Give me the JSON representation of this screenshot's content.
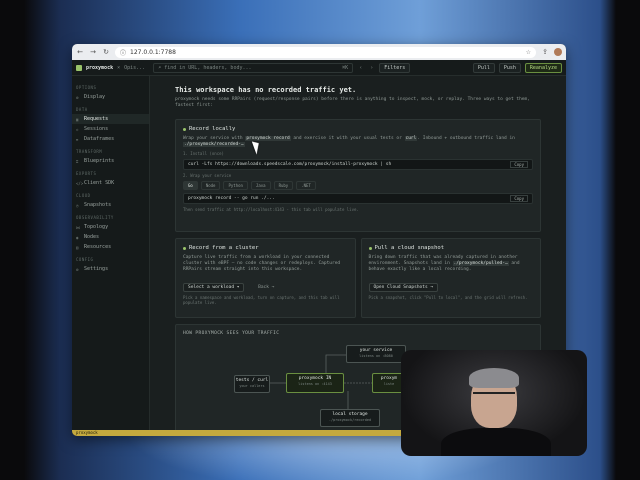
{
  "browser": {
    "url": "127.0.0.1:7788",
    "back": "←",
    "forward": "→",
    "reload": "↻",
    "info": "ⓘ",
    "star": "☆",
    "share": "⇪"
  },
  "topbar": {
    "brand": "proxymock",
    "tab_sep": "×",
    "tab_label": "Opis...",
    "search_placeholder": "find in URL, headers, body...",
    "shortcut": "⌘K",
    "prev": "‹",
    "next": "›",
    "filters": "Filters",
    "pull": "Pull",
    "push": "Push",
    "reanalyze": "Reanalyze"
  },
  "sidebar": {
    "sections": [
      {
        "title": "OPTIONS",
        "items": [
          {
            "icon": "⚙",
            "label": "Display",
            "active": false
          }
        ]
      },
      {
        "title": "DATA",
        "items": [
          {
            "icon": "▣",
            "label": "Requests",
            "active": true
          },
          {
            "icon": "◇",
            "label": "Sessions",
            "active": false
          },
          {
            "icon": "≡",
            "label": "Dataframes",
            "active": false
          }
        ]
      },
      {
        "title": "TRANSFORM",
        "items": [
          {
            "icon": "⌗",
            "label": "Blueprints",
            "active": false
          }
        ]
      },
      {
        "title": "EXPORTS",
        "items": [
          {
            "icon": "</>",
            "label": "Client SDK",
            "active": false
          }
        ]
      },
      {
        "title": "CLOUD",
        "items": [
          {
            "icon": "◷",
            "label": "Snapshots",
            "active": false
          }
        ]
      },
      {
        "title": "OBSERVABILITY",
        "items": [
          {
            "icon": "⋈",
            "label": "Topology",
            "active": false
          },
          {
            "icon": "◉",
            "label": "Nodes",
            "active": false
          },
          {
            "icon": "▤",
            "label": "Resources",
            "active": false
          }
        ]
      },
      {
        "title": "CONFIG",
        "items": [
          {
            "icon": "⚙",
            "label": "Settings",
            "active": false
          }
        ]
      }
    ]
  },
  "main": {
    "title": "This workspace has no recorded traffic yet.",
    "lead": "proxymock needs some RRPairs (request/response pairs) before there is anything to inspect, mock, or replay. Three ways to get them, fastest first:",
    "record": {
      "title": "Record locally",
      "p1": "Wrap your service with",
      "p1_code": "proxymock record",
      "p2": "and exercise it with your usual tests or",
      "p2_code": "curl",
      "p3": ". Inbound + outbound traffic land in",
      "p3_code": "./proxymock/recorded-…",
      "step1": "1. Install (once)",
      "install_cmd": "curl -Lfs https://downloads.speedscale.com/proxymock/install-proxymock | sh",
      "copy": "Copy",
      "step2": "2. Wrap your service",
      "langs": [
        "Go",
        "Node",
        "Python",
        "Java",
        "Ruby",
        ".NET"
      ],
      "record_cmd": "proxymock record -- go run ./...",
      "hint": "Then send traffic at http://localhost:4143 - this tab will populate live."
    },
    "cluster": {
      "title": "Record from a cluster",
      "body": "Capture live traffic from a workload in your connected cluster with eBPF — no code changes or redeploys. Captured RRPairs stream straight into this workspace.",
      "btn": "Select a workload ▾",
      "btn2": "Back →",
      "note": "Pick a namespace and workload, turn on capture, and this tab will populate live."
    },
    "snapshot": {
      "title": "Pull a cloud snapshot",
      "body_a": "Bring down traffic that was already captured in another environment. Snapshots land in",
      "body_code": "./proxymock/pulled-…",
      "body_b": "and behave exactly like a local recording.",
      "btn": "Open Cloud Snapshots →",
      "note": "Pick a snapshot, click \"Pull to local\", and the grid will refresh."
    },
    "how": {
      "title": "HOW PROXYMOCK SEES YOUR TRAFFIC",
      "tests_label": "tests / curl",
      "tests_sub": "your callers",
      "proxy_label": "proxymock IN",
      "proxy_sub": "listens on :4143",
      "service_label": "your service",
      "service_sub": "listens on :8080",
      "proxy_out_label": "proxym",
      "proxy_out_sub": "liste",
      "storage_label": "local storage",
      "storage_sub": "./proxymock/recorded"
    }
  },
  "statusbar": {
    "label": "proxymock"
  }
}
